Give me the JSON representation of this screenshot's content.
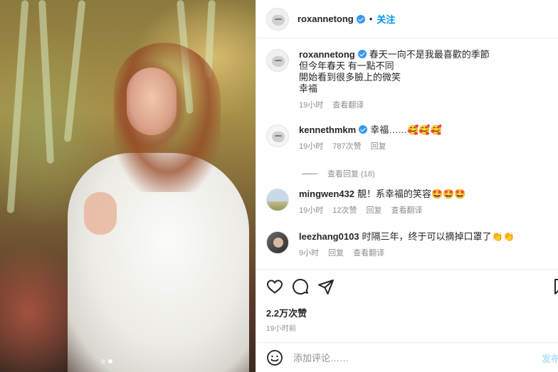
{
  "post": {
    "username": "roxannetong",
    "follow_label": "关注",
    "separator": "•"
  },
  "caption": {
    "username": "roxannetong",
    "lines": [
      "春天一向不是我最喜歡的季節",
      "但今年春天 有一點不同",
      "開始看到很多臉上的微笑",
      "幸福"
    ],
    "time": "19小时",
    "translate": "查看翻译"
  },
  "comments": [
    {
      "username": "kennethmkm",
      "verified": true,
      "text": "幸福……🥰🥰🥰",
      "time": "19小时",
      "likes": "787次赞",
      "reply": "回复"
    },
    {
      "username": "mingwen432",
      "verified": false,
      "text": "靚！系幸福的笑容🤩🤩🤩",
      "time": "19小时",
      "likes": "12次赞",
      "reply": "回复",
      "translate": "查看翻译"
    },
    {
      "username": "leezhang0103",
      "verified": false,
      "text": "时隔三年，终于可以摘掉口罩了👏👏",
      "time": "9小时",
      "reply": "回复",
      "translate": "查看翻译"
    }
  ],
  "view_replies": "查看回复 (18)",
  "stats": {
    "likes": "2.2万次赞",
    "posted": "19小时前"
  },
  "comment_box": {
    "placeholder": "添加评论……",
    "post_label": "发布"
  },
  "carousel": {
    "count": 2,
    "active": 2
  },
  "icons": [
    "heart-icon",
    "comment-icon",
    "share-icon",
    "bookmark-icon",
    "emoji-icon"
  ],
  "colors": {
    "accent": "#0095f6",
    "verified": "#3897f0",
    "muted": "#8e8e8e"
  }
}
